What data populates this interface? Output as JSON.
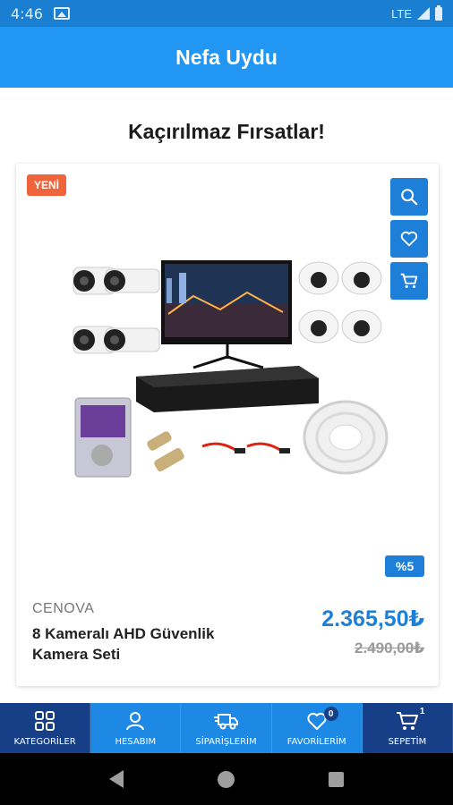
{
  "status_bar": {
    "time": "4:46",
    "network": "LTE"
  },
  "app_bar": {
    "title": "Nefa Uydu"
  },
  "section": {
    "title": "Kaçırılmaz Fırsatlar!"
  },
  "product": {
    "badge": "YENİ",
    "discount": "%5",
    "brand": "CENOVA",
    "name": "8 Kameralı AHD Güvenlik Kamera Seti",
    "price": "2.365,50₺",
    "old_price": "2.490,00₺",
    "image_icon": "cctv-kit-image",
    "actions": [
      {
        "icon": "search-icon"
      },
      {
        "icon": "heart-icon"
      },
      {
        "icon": "cart-icon"
      }
    ]
  },
  "bottom_nav": {
    "items": [
      {
        "label": "KATEGORİLER",
        "icon": "grid-icon",
        "count": ""
      },
      {
        "label": "HESABIM",
        "icon": "user-icon",
        "count": ""
      },
      {
        "label": "SİPARİŞLERİM",
        "icon": "truck-icon",
        "count": ""
      },
      {
        "label": "FAVORİLERİM",
        "icon": "heart-icon",
        "count": "0"
      },
      {
        "label": "SEPETİM",
        "icon": "cart-icon",
        "count": "1"
      }
    ]
  },
  "colors": {
    "primary": "#2196f3",
    "dark": "#163f87",
    "accent_badge": "#f0643c",
    "price": "#1e7fd8"
  }
}
